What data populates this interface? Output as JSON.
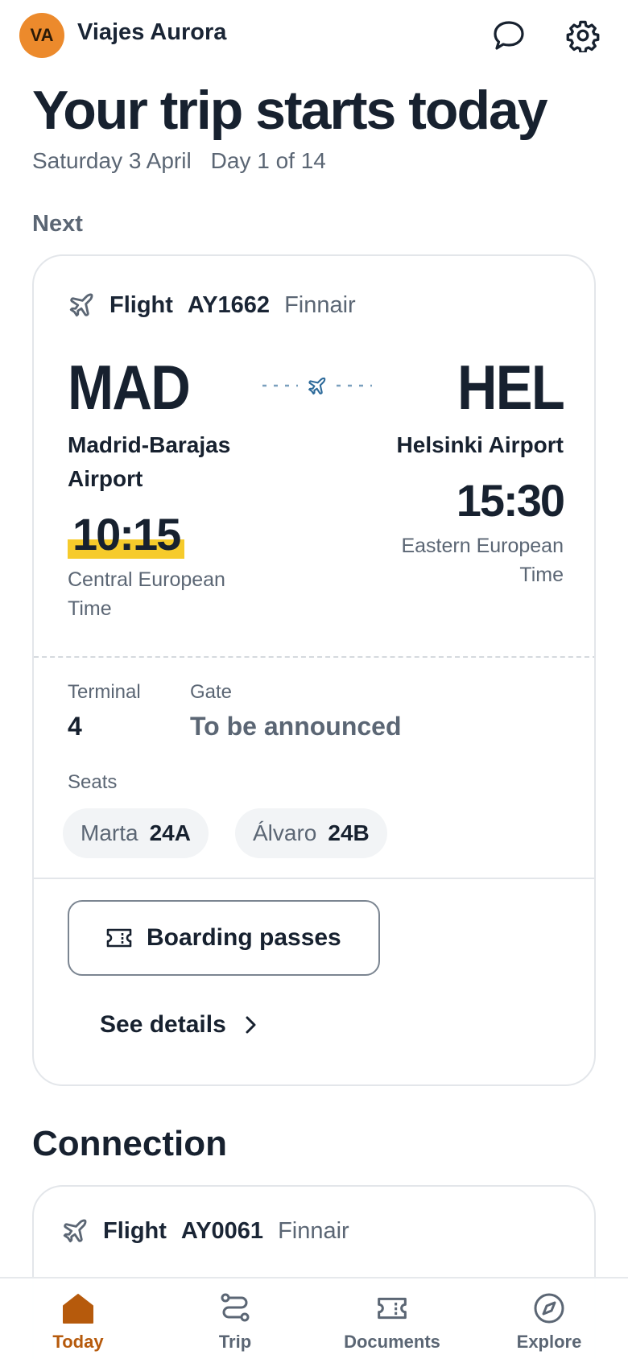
{
  "header": {
    "avatar_initials": "VA",
    "brand": "Viajes Aurora",
    "icons": [
      "chat-icon",
      "settings-gear-icon"
    ]
  },
  "hero": {
    "title": "Your trip starts today",
    "date": "Saturday 3 April",
    "day_progress": "Day 1 of 14"
  },
  "next": {
    "section_label": "Next",
    "flight": {
      "type_label": "Flight",
      "number": "AY1662",
      "airline": "Finnair",
      "origin": {
        "code": "MAD",
        "airport": "Madrid-Barajas Airport",
        "time": "10:15",
        "timezone": "Central European Time"
      },
      "destination": {
        "code": "HEL",
        "airport": "Helsinki Airport",
        "time": "15:30",
        "timezone": "Eastern European Time"
      },
      "terminal_label": "Terminal",
      "terminal": "4",
      "gate_label": "Gate",
      "gate": "To be announced",
      "seats_label": "Seats",
      "seats": [
        {
          "name": "Marta",
          "seat": "24A"
        },
        {
          "name": "Álvaro",
          "seat": "24B"
        }
      ],
      "boarding_button": "Boarding passes",
      "details_link": "See details"
    }
  },
  "connection": {
    "section_label": "Connection",
    "flight": {
      "type_label": "Flight",
      "number": "AY0061",
      "airline": "Finnair"
    }
  },
  "tabbar": {
    "active": "Today",
    "tabs": [
      {
        "label": "Today",
        "icon": "home-icon"
      },
      {
        "label": "Trip",
        "icon": "route-icon"
      },
      {
        "label": "Documents",
        "icon": "ticket-icon"
      },
      {
        "label": "Explore",
        "icon": "compass-icon"
      }
    ]
  },
  "colors": {
    "accent_orange": "#ec8a2c",
    "active_tab": "#b65a0c",
    "time_highlight": "#f6cb2b",
    "text_dark": "#17212f",
    "text_muted": "#5b6674"
  }
}
